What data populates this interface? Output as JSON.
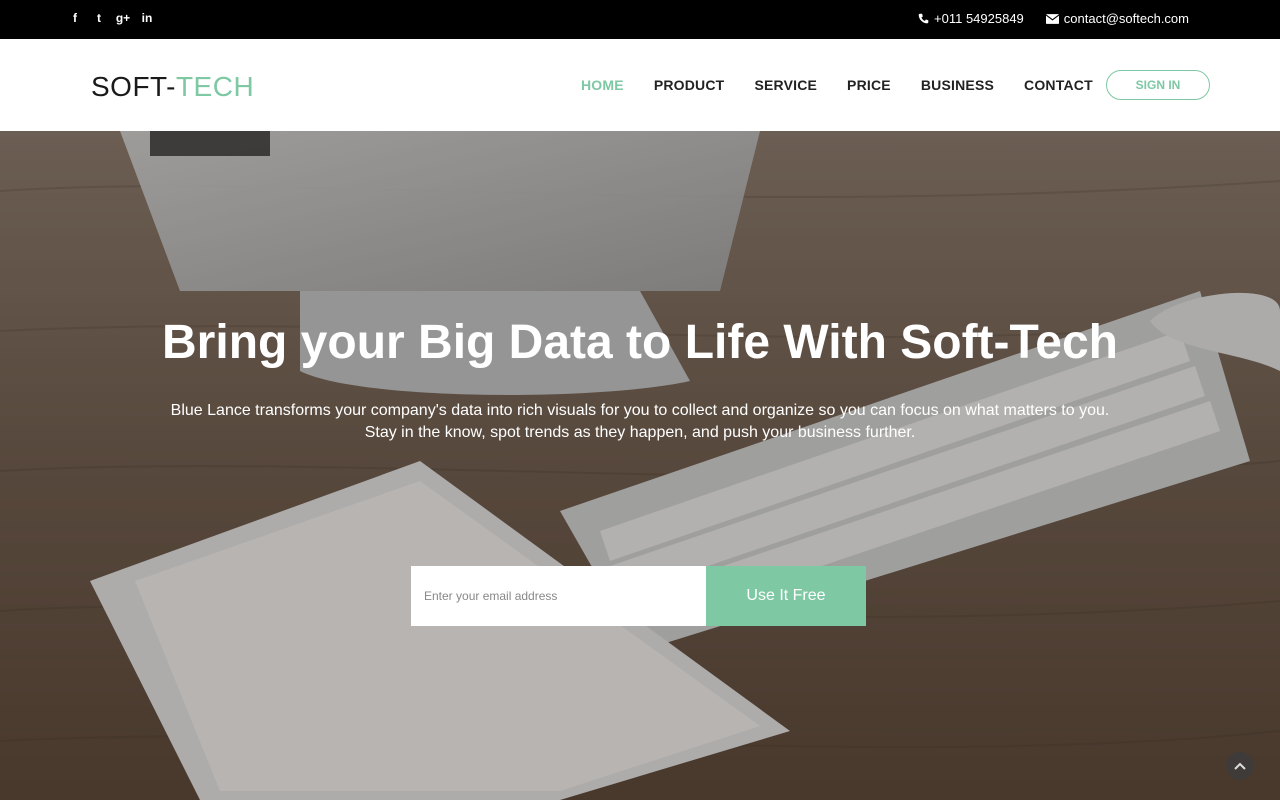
{
  "topbar": {
    "social": [
      {
        "name": "facebook",
        "glyph": "f"
      },
      {
        "name": "twitter",
        "glyph": "t"
      },
      {
        "name": "google-plus",
        "glyph": "g+"
      },
      {
        "name": "linkedin",
        "glyph": "in"
      }
    ],
    "phone": "+011 54925849",
    "email": "contact@softech.com"
  },
  "header": {
    "logo_part1": "SOFT-",
    "logo_part2": "TECH",
    "nav": [
      "HOME",
      "PRODUCT",
      "SERVICE",
      "PRICE",
      "BUSINESS",
      "CONTACT"
    ],
    "active_nav": "HOME",
    "signin_label": "SIGN IN"
  },
  "hero": {
    "title": "Bring your Big Data to Life With Soft-Tech",
    "subtitle": "Blue Lance transforms your company's data into rich visuals for you to collect and organize so you can focus on what matters to you. Stay in the know, spot trends as they happen, and push your business further.",
    "email_placeholder": "Enter your email address",
    "email_value": "",
    "cta_label": "Use It Free"
  },
  "colors": {
    "accent": "#7ec8a3",
    "topbar_bg": "#000000"
  },
  "icons": [
    "facebook-icon",
    "twitter-icon",
    "google-plus-icon",
    "linkedin-icon",
    "phone-icon",
    "envelope-icon",
    "chevron-up-icon"
  ]
}
